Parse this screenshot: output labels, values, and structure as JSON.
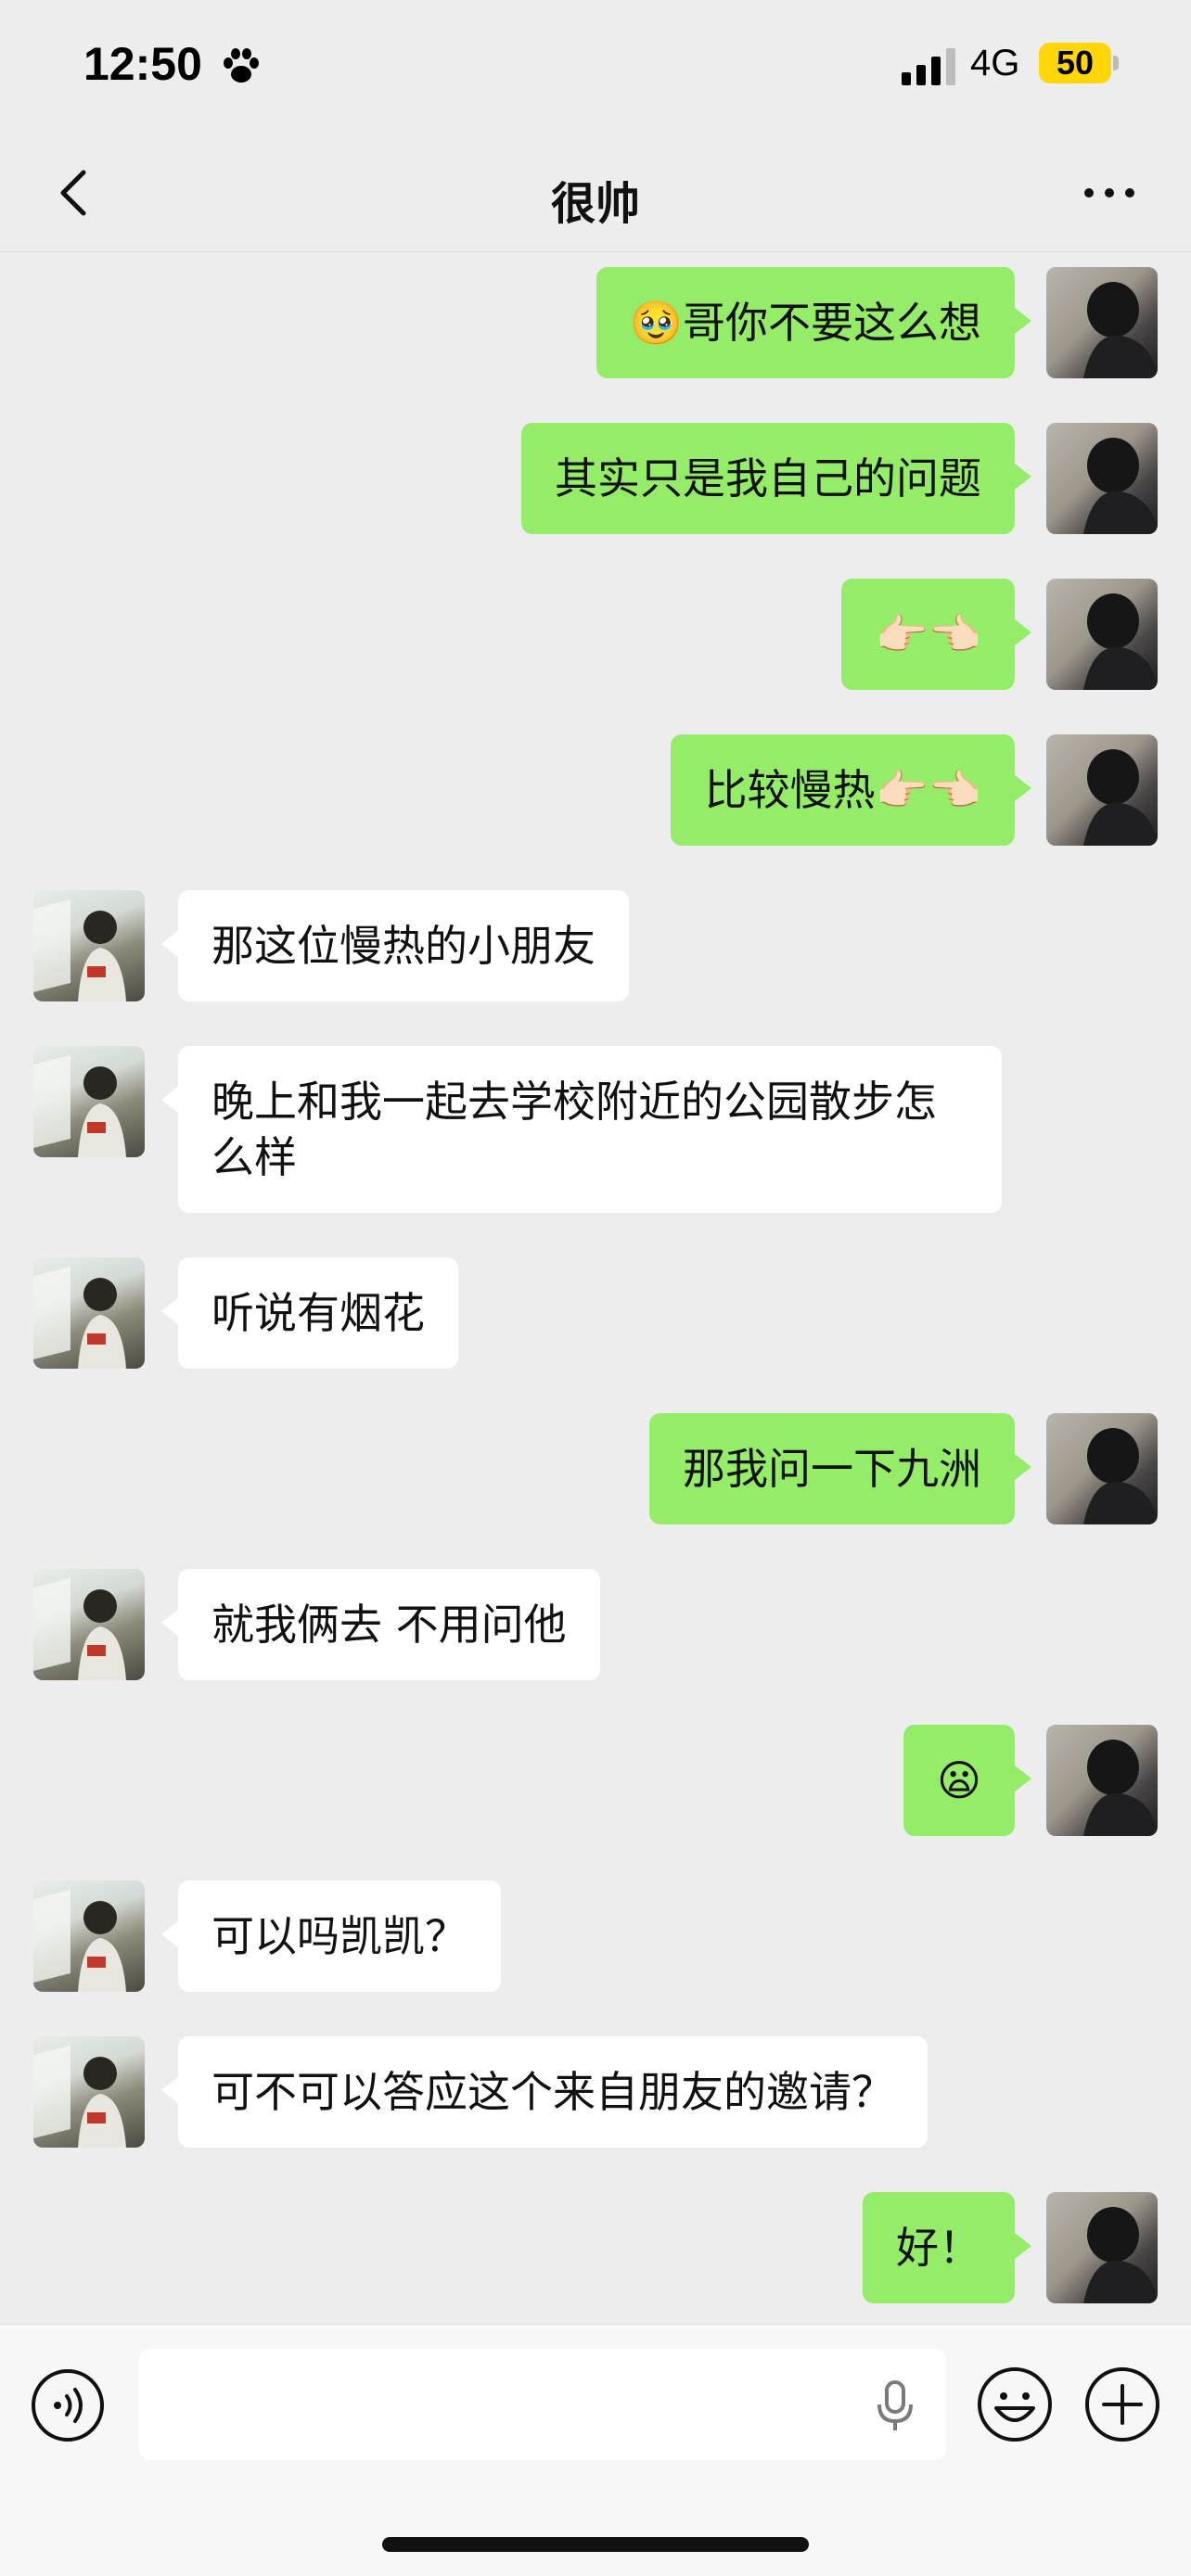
{
  "status_bar": {
    "time": "12:50",
    "network": "4G",
    "battery": "50",
    "paw_icon": "paw-icon",
    "signal_icon": "signal-icon"
  },
  "nav": {
    "title": "很帅",
    "back_icon": "chevron-left-icon",
    "more_icon": "more-icon"
  },
  "messages": [
    {
      "sender": "self",
      "text": "🥹哥你不要这么想"
    },
    {
      "sender": "self",
      "text": "其实只是我自己的问题"
    },
    {
      "sender": "self",
      "text": "👉🏻👈🏻"
    },
    {
      "sender": "self",
      "text": "比较慢热👉🏻👈🏻"
    },
    {
      "sender": "other",
      "text": "那这位慢热的小朋友"
    },
    {
      "sender": "other",
      "text": "晚上和我一起去学校附近的公园散步怎么样"
    },
    {
      "sender": "other",
      "text": "听说有烟花"
    },
    {
      "sender": "self",
      "text": "那我问一下九洲"
    },
    {
      "sender": "other",
      "text": "就我俩去 不用问他"
    },
    {
      "sender": "self",
      "text": "😦"
    },
    {
      "sender": "other",
      "text": "可以吗凯凯？"
    },
    {
      "sender": "other",
      "text": "可不可以答应这个来自朋友的邀请？"
    },
    {
      "sender": "self",
      "text": "好！"
    }
  ],
  "input_bar": {
    "text_value": "",
    "voice_icon": "voice-icon",
    "mic_icon": "mic-icon",
    "emoji_icon": "emoji-icon",
    "plus_icon": "plus-icon"
  },
  "colors": {
    "background": "#ededed",
    "self_bubble": "#95ec69",
    "other_bubble": "#ffffff",
    "battery": "#ffd60a"
  }
}
